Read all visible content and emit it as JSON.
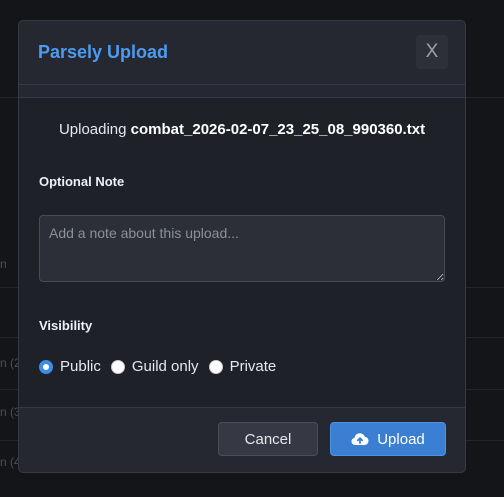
{
  "modal": {
    "title": "Parsely Upload",
    "close_label": "X",
    "uploading_prefix": "Uploading",
    "filename": "combat_2026-02-07_23_25_08_990360.txt",
    "note": {
      "label": "Optional Note",
      "placeholder": "Add a note about this upload...",
      "value": ""
    },
    "visibility": {
      "label": "Visibility",
      "options": [
        {
          "label": "Public",
          "checked": true
        },
        {
          "label": "Guild only",
          "checked": false
        },
        {
          "label": "Private",
          "checked": false
        }
      ]
    },
    "buttons": {
      "cancel": "Cancel",
      "upload": "Upload",
      "upload_icon": "cloud-upload-icon"
    }
  },
  "background": {
    "fragments": [
      "n",
      "n (2",
      "n (3",
      "n (4"
    ]
  }
}
